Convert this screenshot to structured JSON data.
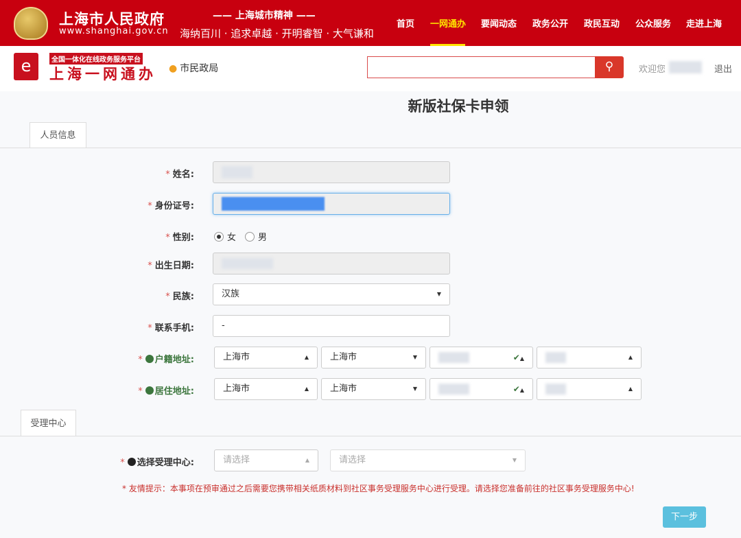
{
  "header": {
    "gov_title": "上海市人民政府",
    "gov_url": "www.shanghai.gov.cn",
    "spirit_title": "—— 上海城市精神 ——",
    "spirit_slogan": "海纳百川 · 追求卓越 · 开明睿智 · 大气谦和",
    "nav": [
      "首页",
      "一网通办",
      "要闻动态",
      "政务公开",
      "政民互动",
      "公众服务",
      "走进上海"
    ],
    "active_nav": "一网通办"
  },
  "subheader": {
    "logo_tag": "全国一体化在线政务服务平台",
    "logo_main": "上海一网通办",
    "location": "市民政局",
    "search_placeholder": "",
    "welcome": "欢迎您",
    "logout": "退出"
  },
  "page": {
    "title": "新版社保卡申领"
  },
  "person_tab": "人员信息",
  "form": {
    "name_label": "姓名:",
    "id_label": "身份证号:",
    "gender_label": "性别:",
    "gender_options": [
      "女",
      "男"
    ],
    "gender_selected": "女",
    "birth_label": "出生日期:",
    "ethnicity_label": "民族:",
    "ethnicity_value": "汉族",
    "phone_label": "联系手机:",
    "phone_value": "-",
    "huji_label": "户籍地址:",
    "huji": [
      "上海市",
      "上海市"
    ],
    "residence_label": "居住地址:",
    "residence": [
      "上海市",
      "上海市"
    ]
  },
  "center_tab": "受理中心",
  "center": {
    "label": "选择受理中心:",
    "placeholder1": "请选择",
    "placeholder2": "请选择",
    "tip": "* 友情提示：本事项在预审通过之后需要您携带相关纸质材料到社区事务受理服务中心进行受理。请选择您准备前往的社区事务受理服务中心!"
  },
  "next_button": "下一步",
  "colors": {
    "brand_red": "#c8000f",
    "nav_active": "#ffe400",
    "button": "#5bc0de",
    "tip": "#c9302c"
  }
}
